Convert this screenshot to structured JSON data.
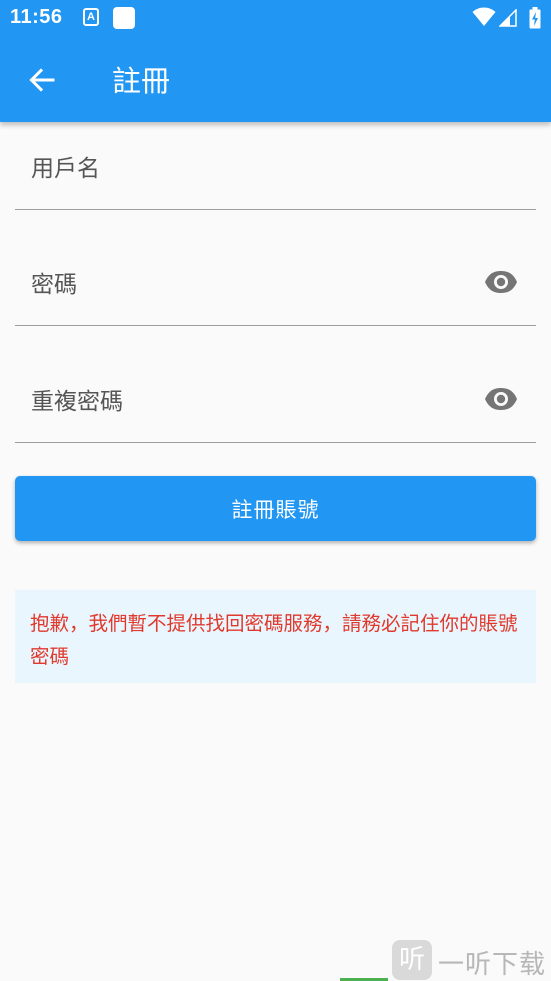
{
  "status_bar": {
    "time": "11:56",
    "notification_icons": [
      "text-a-notification-icon",
      "square-notification-icon"
    ],
    "system_icons": [
      "wifi-icon",
      "cell-signal-icon",
      "battery-charging-icon"
    ],
    "a_glyph": "A"
  },
  "app_bar": {
    "back_icon": "arrow-left-icon",
    "title": "註冊"
  },
  "form": {
    "username": {
      "placeholder": "用戶名",
      "value": ""
    },
    "password": {
      "placeholder": "密碼",
      "value": "",
      "toggle_icon": "eye-icon"
    },
    "confirm_password": {
      "placeholder": "重複密碼",
      "value": "",
      "toggle_icon": "eye-icon"
    },
    "submit_label": "註冊賬號"
  },
  "notice": {
    "text": "抱歉，我們暫不提供找回密碼服務，請務必記住你的賬號密碼"
  },
  "watermark": {
    "logo_glyph": "听",
    "text": "一听下载"
  },
  "colors": {
    "primary": "#2196f3",
    "notice_text": "#e03a2f",
    "notice_bg": "#eaf6fd",
    "background": "#fafafa"
  }
}
